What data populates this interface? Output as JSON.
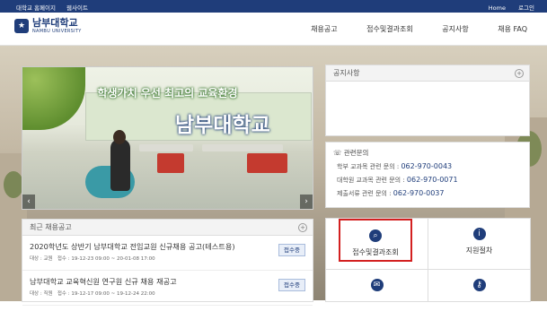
{
  "topbar": {
    "left": [
      "대학교 홈페이지",
      "웹사이트"
    ],
    "right": [
      "Home",
      "로그인"
    ]
  },
  "header": {
    "logo_ko": "남부대학교",
    "logo_en": "NAMBU UNIVERSITY",
    "nav": [
      "채용공고",
      "접수및결과조회",
      "공지사항",
      "채용 FAQ"
    ]
  },
  "slider": {
    "title": "학생가치 우선 최고의 교육환경",
    "subtitle": "남부대학교"
  },
  "notice": {
    "title": "공지사항"
  },
  "contact": {
    "title": "관련문의",
    "rows": [
      {
        "label": "학부 교과목 관련 문의 :",
        "phone": "062-970-0043"
      },
      {
        "label": "대학원 교과목 관련 문의 :",
        "phone": "062-970-0071"
      },
      {
        "label": "제출서류 관련 문의 :",
        "phone": "062-970-0037"
      }
    ]
  },
  "recent": {
    "title": "최근 채용공고",
    "items": [
      {
        "title": "2020학년도 상반기 남부대학교 전임교원 신규채용 공고(테스트용)",
        "meta_target_label": "대상 :",
        "meta_target": "교원",
        "meta_period_label": "접수 :",
        "meta_period": "19-12-23 09:00 ~ 20-01-08 17:00",
        "status": "접수중"
      },
      {
        "title": "남부대학교 교육혁신원 연구원 신규 채용 재공고",
        "meta_target_label": "대상 :",
        "meta_target": "직원",
        "meta_period_label": "접수 :",
        "meta_period": "19-12-17 09:00 ~ 19-12-24 22:00",
        "status": "접수중"
      }
    ]
  },
  "tiles": [
    {
      "label": "접수및결과조회",
      "icon": "search-icon"
    },
    {
      "label": "지원절차",
      "icon": "info-icon"
    },
    {
      "label": "",
      "icon": "chat-icon"
    },
    {
      "label": "",
      "icon": "key-icon"
    }
  ],
  "colors": {
    "brand": "#1f3d7a",
    "highlight": "#d32020"
  }
}
